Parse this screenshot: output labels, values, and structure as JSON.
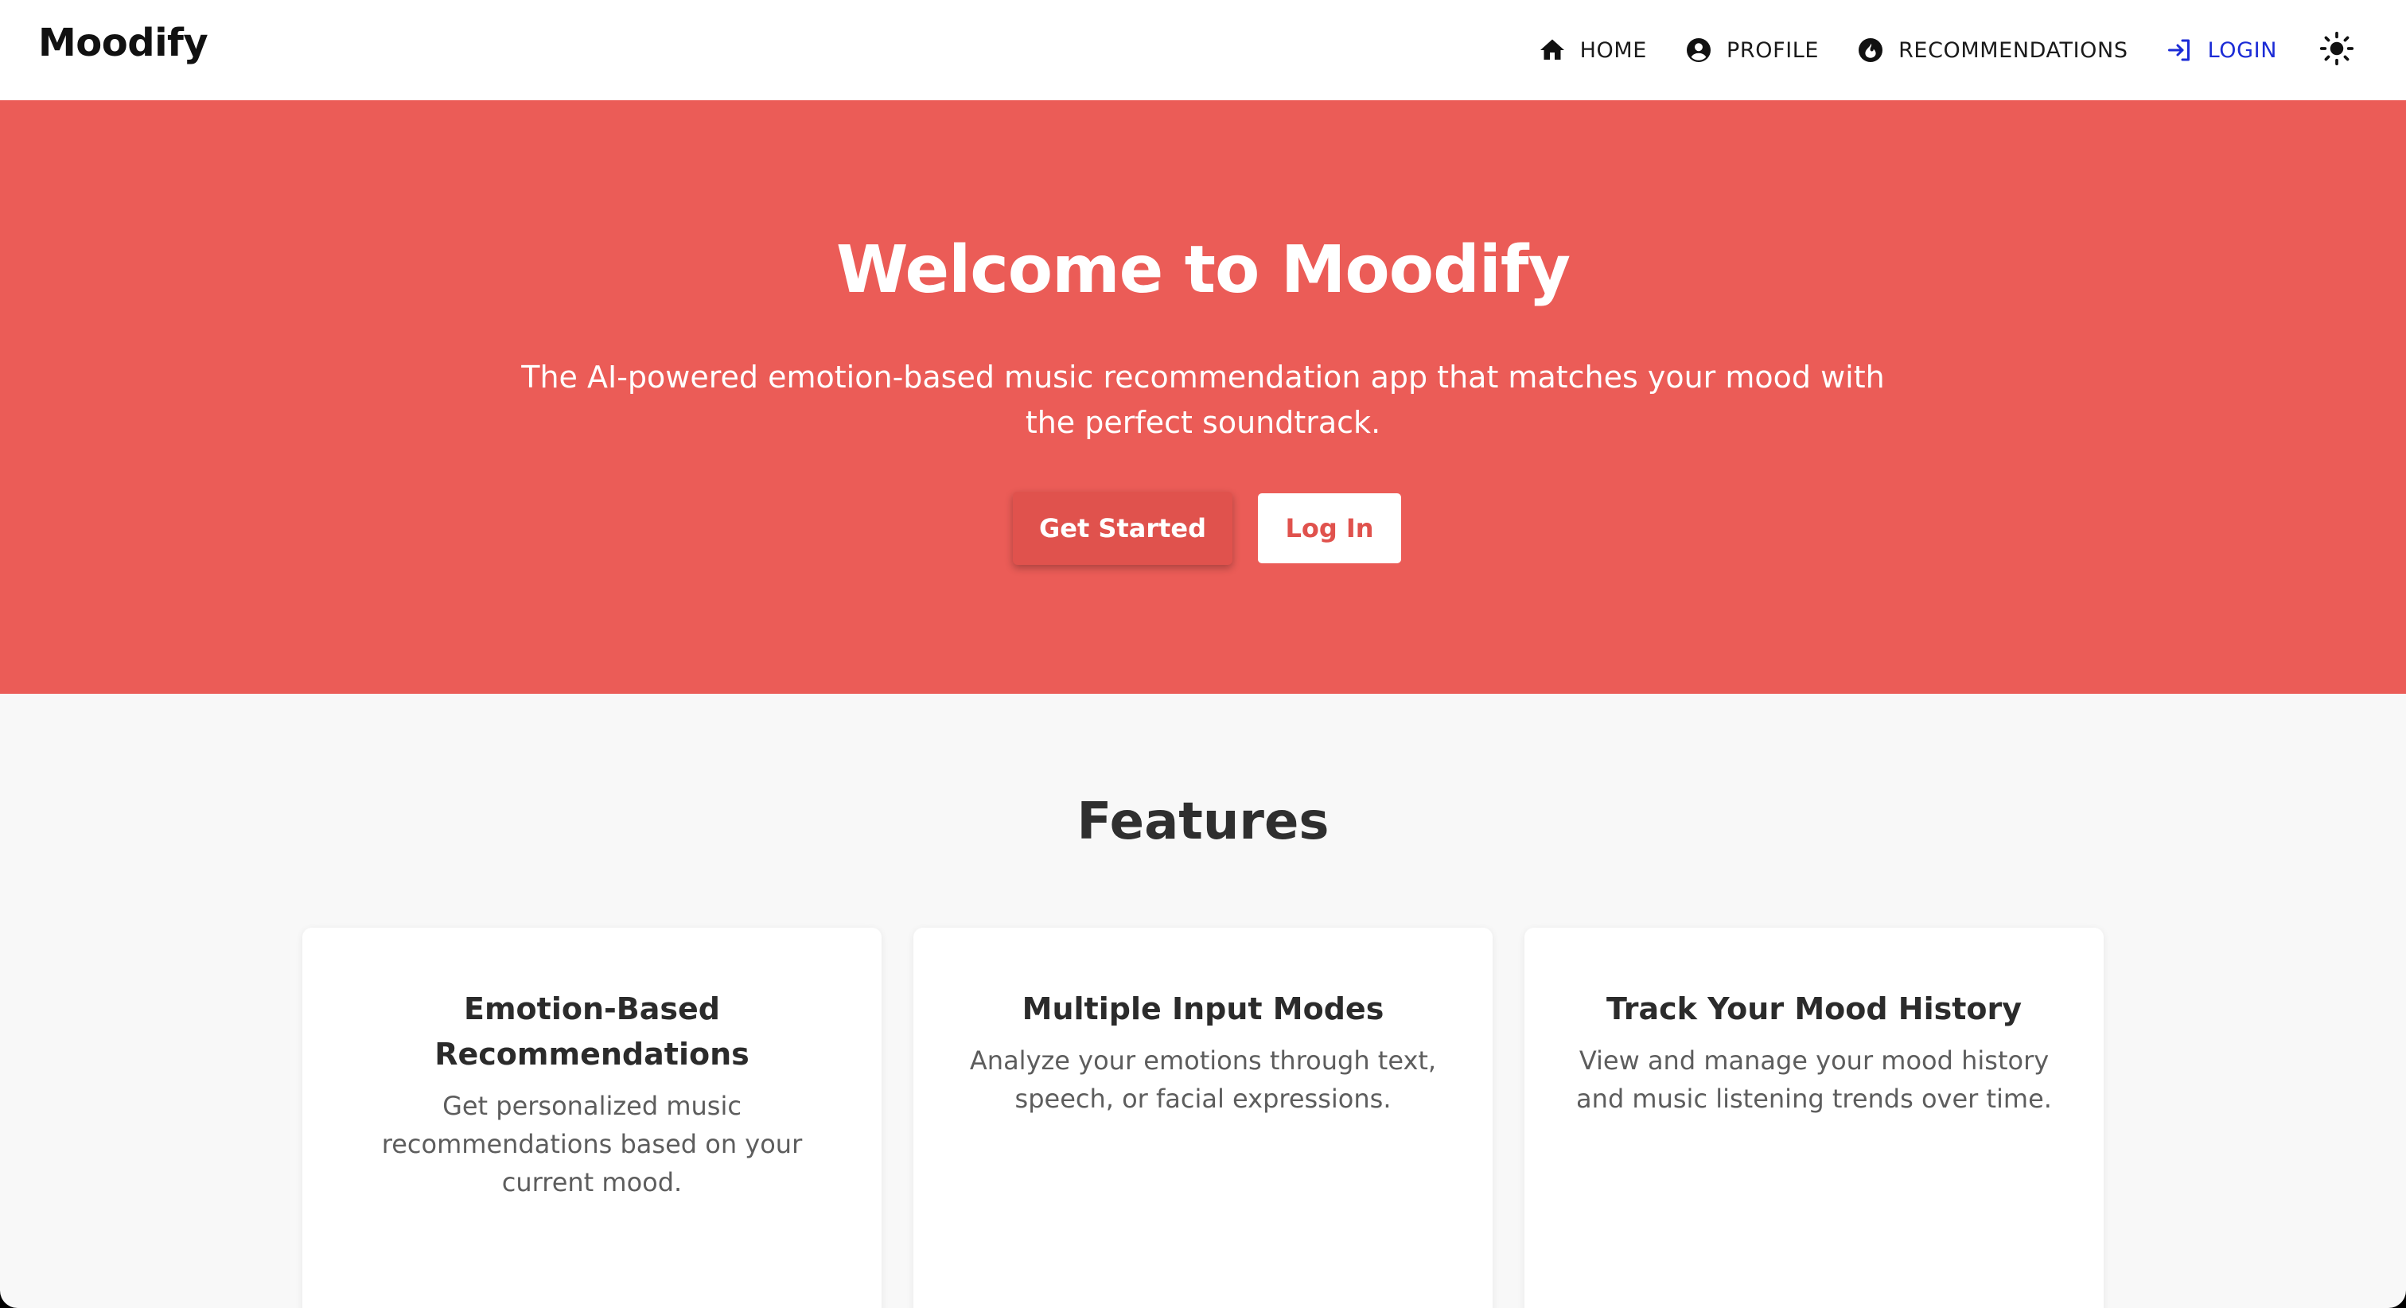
{
  "navbar": {
    "brand": "Moodify",
    "items": [
      {
        "label": "HOME",
        "icon": "home-icon"
      },
      {
        "label": "PROFILE",
        "icon": "account-circle-icon"
      },
      {
        "label": "RECOMMENDATIONS",
        "icon": "recommendation-icon"
      },
      {
        "label": "LOGIN",
        "icon": "login-icon"
      }
    ],
    "theme_toggle_icon": "sun-icon",
    "login_color": "#1b2bd6"
  },
  "hero": {
    "title": "Welcome to Moodify",
    "subtitle": "The AI-powered emotion-based music recommendation app that matches your mood with the perfect soundtrack.",
    "primary_button": "Get Started",
    "secondary_button": "Log In",
    "background_color": "#eb5c57",
    "accent_color": "#e0524d"
  },
  "features": {
    "title": "Features",
    "cards": [
      {
        "title": "Emotion-Based Recommendations",
        "description": "Get personalized music recommendations based on your current mood."
      },
      {
        "title": "Multiple Input Modes",
        "description": "Analyze your emotions through text, speech, or facial expressions."
      },
      {
        "title": "Track Your Mood History",
        "description": "View and manage your mood history and music listening trends over time."
      }
    ]
  }
}
